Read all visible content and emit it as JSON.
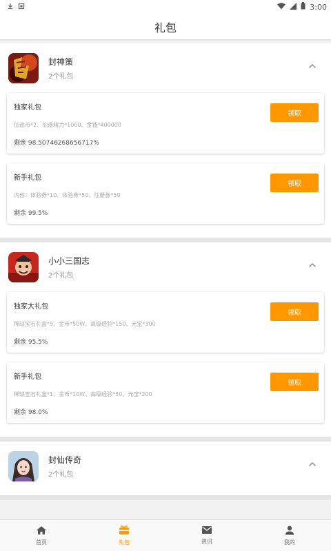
{
  "status_bar": {
    "time": "3:00"
  },
  "header": {
    "title": "礼包"
  },
  "games": [
    {
      "name": "封神策",
      "count": "2个礼包",
      "icon": "game-icon-fengshen",
      "gifts": [
        {
          "name": "独家礼包",
          "desc": "仙途币*2、仙途精力*1000、金钱*400000",
          "remain": "剩余 98.50746268656717%",
          "button": "领取"
        },
        {
          "name": "新手礼包",
          "desc": "内容：体验券*10、体验券*50、注册券*50",
          "remain": "剩余 99.5%",
          "button": "领取"
        }
      ]
    },
    {
      "name": "小小三国志",
      "count": "2个礼包",
      "icon": "game-icon-sanguo",
      "gifts": [
        {
          "name": "独家大礼包",
          "desc": "稀缺宝石礼盒*5、金币*50W、高级经验*150、元宝*300",
          "remain": "剩余 95.5%",
          "button": "领取"
        },
        {
          "name": "新手礼包",
          "desc": "稀缺宝石礼盒*1、金币*10W、高级经验*50、元宝*200",
          "remain": "剩余 98.0%",
          "button": "领取"
        }
      ]
    },
    {
      "name": "封仙传奇",
      "count": "2个礼包",
      "icon": "game-icon-fengxian",
      "gifts": []
    }
  ],
  "nav": [
    {
      "label": "首页",
      "icon": "home-icon"
    },
    {
      "label": "礼包",
      "icon": "gift-icon"
    },
    {
      "label": "资讯",
      "icon": "mail-icon"
    },
    {
      "label": "我的",
      "icon": "person-icon"
    }
  ],
  "colors": {
    "accent": "#ff9800"
  }
}
